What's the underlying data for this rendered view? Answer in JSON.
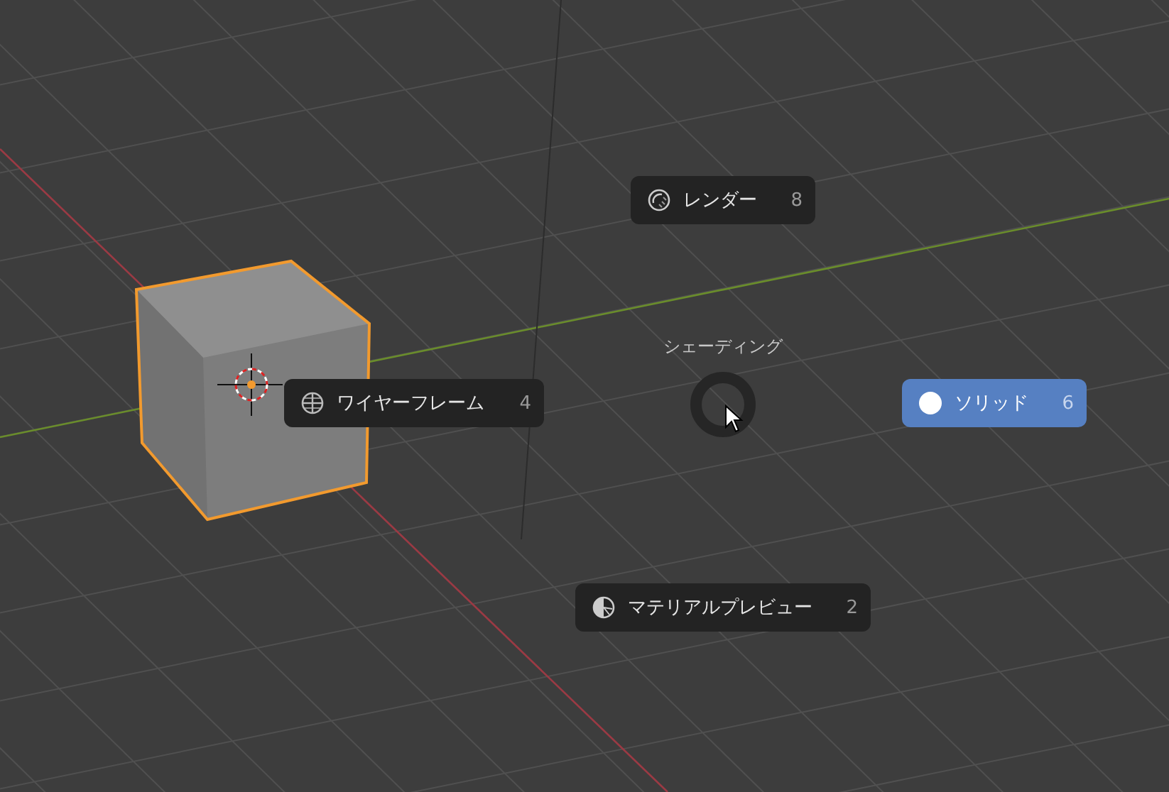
{
  "pie_menu": {
    "title": "シェーディング",
    "items": [
      {
        "kind": "rendered",
        "label": "レンダー",
        "shortcut": "8",
        "selected": false
      },
      {
        "kind": "wireframe",
        "label": "ワイヤーフレーム",
        "shortcut": "4",
        "selected": false
      },
      {
        "kind": "solid",
        "label": "ソリッド",
        "shortcut": "6",
        "selected": true
      },
      {
        "kind": "material",
        "label": "マテリアルプレビュー",
        "shortcut": "2",
        "selected": false
      }
    ]
  }
}
